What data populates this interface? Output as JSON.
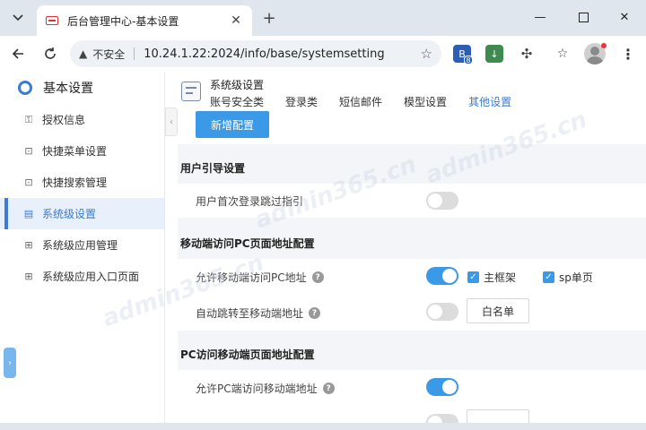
{
  "browser": {
    "tab_title": "后台管理中心-基本设置",
    "address_insecure": "不安全",
    "address_url": "10.24.1.22:2024/info/base/systemsetting",
    "ext_badge": "8"
  },
  "sidebar": {
    "title": "基本设置",
    "items": [
      {
        "label": "授权信息"
      },
      {
        "label": "快捷菜单设置"
      },
      {
        "label": "快捷搜索管理"
      },
      {
        "label": "系统级设置"
      },
      {
        "label": "系统级应用管理"
      },
      {
        "label": "系统级应用入口页面"
      }
    ]
  },
  "header": {
    "title": "系统级设置",
    "tabs": [
      "账号安全类",
      "登录类",
      "短信邮件",
      "模型设置",
      "其他设置"
    ]
  },
  "main": {
    "add_button": "新增配置",
    "sections": [
      {
        "title": "用户引导设置"
      },
      {
        "title": "移动端访问PC页面地址配置"
      },
      {
        "title": "PC访问移动端页面地址配置"
      }
    ],
    "rows": {
      "skip_guide": "用户首次登录跳过指引",
      "mobile_to_pc": "允许移动端访问PC地址",
      "auto_redirect_mobile": "自动跳转至移动端地址",
      "pc_to_mobile": "允许PC端访问移动端地址"
    },
    "checks": {
      "main_frame": "主框架",
      "sp_single": "sp单页"
    },
    "whitelist": "白名单"
  },
  "watermark": "admin365.cn",
  "colors": {
    "accent": "#3a9ae8",
    "active": "#3a7bd5"
  }
}
